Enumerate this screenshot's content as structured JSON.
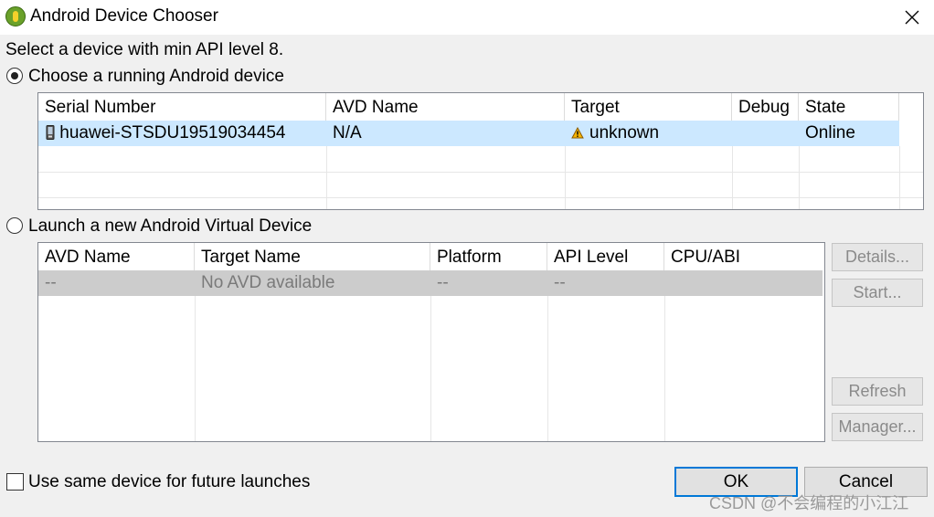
{
  "window": {
    "title": "Android Device Chooser",
    "app_icon": "android-adt-icon",
    "close_icon": "close-icon"
  },
  "instruction": "Select a device with min API level 8.",
  "running_option": {
    "label": "Choose a running Android device",
    "selected": true
  },
  "running_table": {
    "columns": [
      "Serial Number",
      "AVD Name",
      "Target",
      "Debug",
      "State"
    ],
    "rows": [
      {
        "serial": "huawei-STSDU19519034454",
        "serial_icon": "phone-icon",
        "avd_name": "N/A",
        "target": "unknown",
        "target_icon": "warning-icon",
        "debug": "",
        "state": "Online",
        "selected": true
      }
    ],
    "selection_color": "#cce8ff"
  },
  "launch_option": {
    "label": "Launch a new Android Virtual Device",
    "selected": false
  },
  "avd_table": {
    "columns": [
      "AVD Name",
      "Target Name",
      "Platform",
      "API Level",
      "CPU/ABI"
    ],
    "rows": [
      {
        "avd_name": "--",
        "target_name": "No AVD available",
        "platform": "--",
        "api_level": "--",
        "cpu_abi": ""
      }
    ],
    "row_color": "#cccccc"
  },
  "side_buttons": {
    "details": "Details...",
    "start": "Start...",
    "refresh": "Refresh",
    "manager": "Manager..."
  },
  "footer": {
    "checkbox_label": "Use same device for future launches",
    "checkbox_checked": false,
    "ok": "OK",
    "cancel": "Cancel"
  },
  "watermark": "CSDN @不会编程的小江江",
  "colors": {
    "accent": "#0078d7",
    "disabled_text": "#8a8a8a"
  }
}
